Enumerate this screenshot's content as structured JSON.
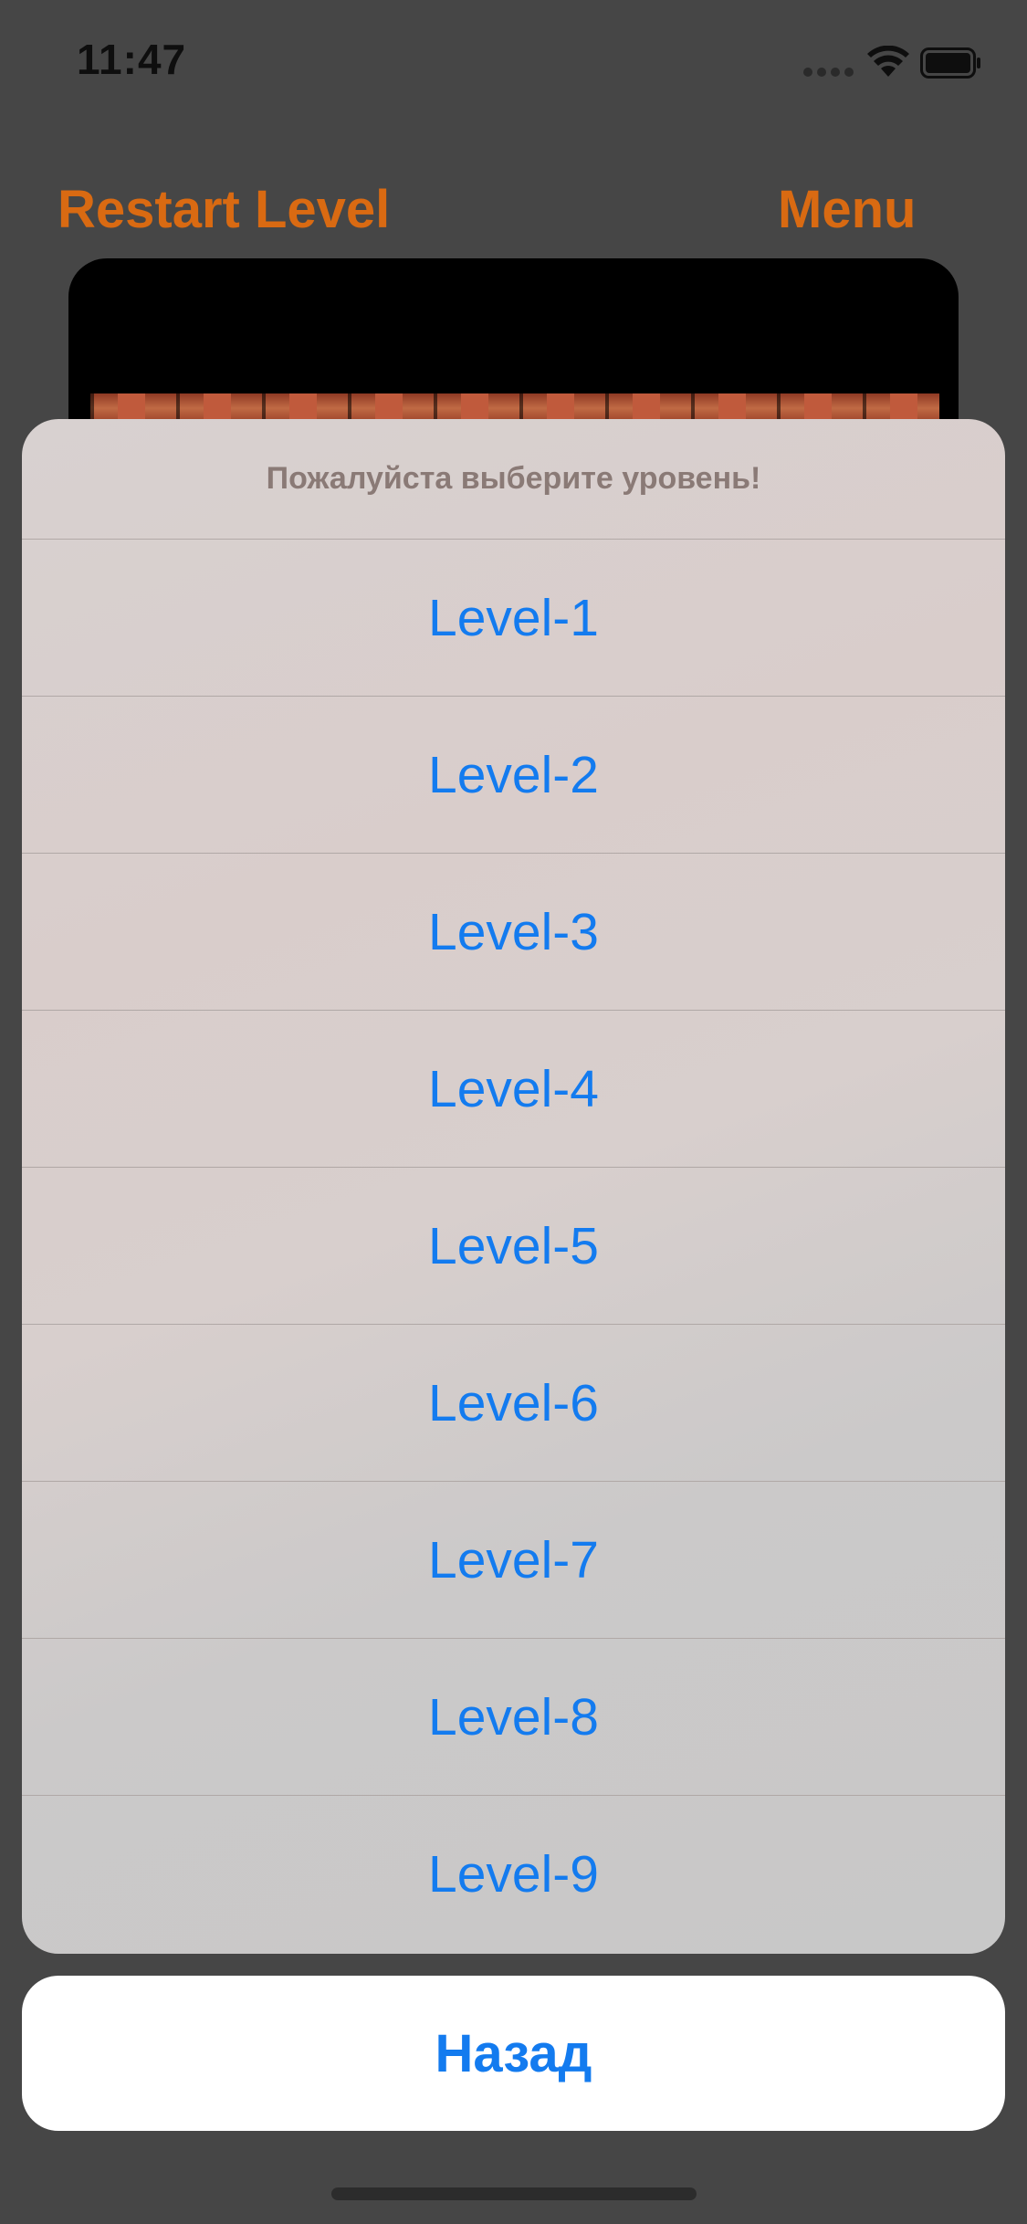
{
  "status_bar": {
    "time": "11:47",
    "icons": [
      "signal-dots-icon",
      "wifi-icon",
      "battery-icon"
    ]
  },
  "toolbar": {
    "restart_label": "Restart Level",
    "menu_label": "Menu"
  },
  "action_sheet": {
    "title": "Пожалуйста выберите уровень!",
    "levels": [
      "Level-1",
      "Level-2",
      "Level-3",
      "Level-4",
      "Level-5",
      "Level-6",
      "Level-7",
      "Level-8",
      "Level-9"
    ],
    "cancel_label": "Назад"
  },
  "colors": {
    "accent_orange": "#d96a12",
    "link_blue": "#137bef",
    "background": "#464646"
  }
}
